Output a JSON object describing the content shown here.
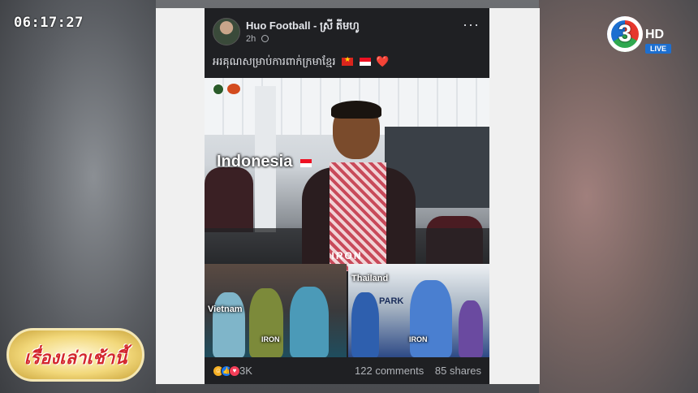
{
  "overlay": {
    "clock": "06:17:27",
    "channel": {
      "number": "3",
      "hd_label": "HD",
      "live_label": "LIVE"
    },
    "show_title": "เรื่องเล่าเช้านี้"
  },
  "post": {
    "author": "Huo Football - ស្រី តីមហូ",
    "time": "2h",
    "more_label": "···",
    "caption": "អរគុណសម្រាប់ការពាក់ក្រមាខ្មែរ",
    "caption_emoji": "❤️",
    "photos": {
      "main_label": "Indonesia",
      "main_watermark": "IRON",
      "left_label": "Vietnam",
      "right_label": "Thailand",
      "right_sign": "PARK",
      "small_watermark": "IRON"
    },
    "reactions": {
      "count": "3K"
    },
    "comments": "122 comments",
    "shares": "85 shares"
  },
  "colors": {
    "post_bg": "#1f2023",
    "text_primary": "#e4e6eb",
    "text_secondary": "#b0b3b8",
    "like_blue": "#1877f2",
    "love_red": "#f33e58",
    "haha_yellow": "#f7b125"
  }
}
